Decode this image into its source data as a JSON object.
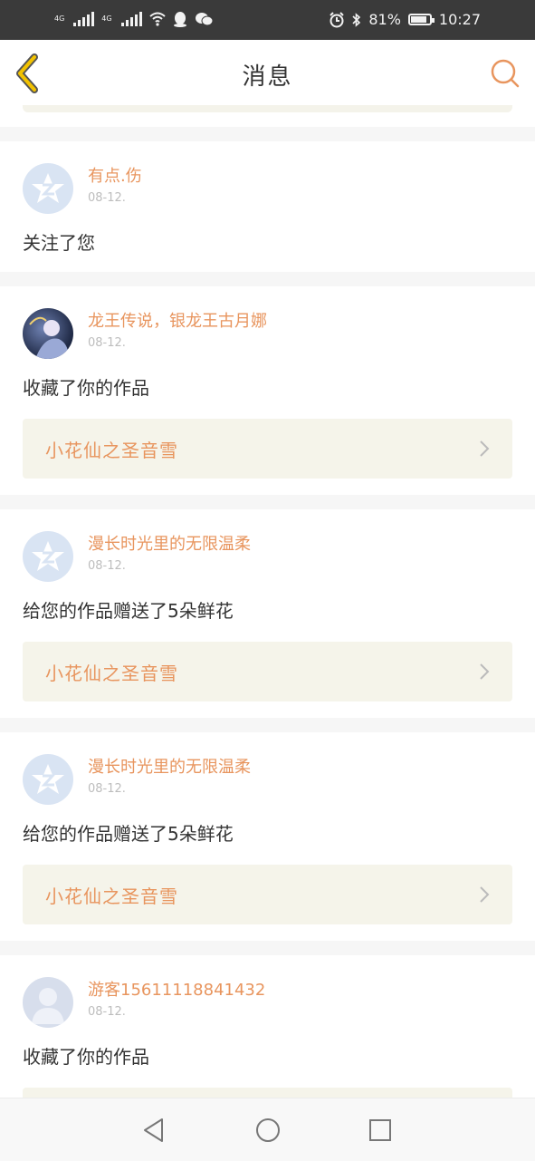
{
  "status_bar": {
    "network_1": "4G",
    "network_2": "4G",
    "battery": "81%",
    "time": "10:27",
    "icons": [
      "signal-icon",
      "signal-icon",
      "wifi-icon",
      "qq-icon",
      "wechat-icon",
      "alarm-icon",
      "bluetooth-icon",
      "battery-icon"
    ]
  },
  "header": {
    "title": "消息",
    "back_icon": "chevron-left-icon",
    "search_icon": "search-icon"
  },
  "messages": [
    {
      "name": "有点.伤",
      "time": "08-12.",
      "text": "关注了您",
      "avatar": "default-avatar"
    },
    {
      "name": "龙王传说，银龙王古月娜",
      "time": "08-12.",
      "text": "收藏了你的作品",
      "avatar": "photo-avatar",
      "work": "小花仙之圣音雪"
    },
    {
      "name": "漫长时光里的无限温柔",
      "time": "08-12.",
      "text": "给您的作品赠送了5朵鲜花",
      "avatar": "default-avatar",
      "work": "小花仙之圣音雪"
    },
    {
      "name": "漫长时光里的无限温柔",
      "time": "08-12.",
      "text": "给您的作品赠送了5朵鲜花",
      "avatar": "default-avatar",
      "work": "小花仙之圣音雪"
    },
    {
      "name": "游客15611118841432",
      "time": "08-12.",
      "text": "收藏了你的作品",
      "avatar": "guest-avatar"
    }
  ],
  "nav": [
    "back-triangle-icon",
    "home-circle-icon",
    "recents-square-icon"
  ],
  "colors": {
    "accent": "#e8955e",
    "work_bg": "#f5f4ea",
    "status_bg": "#3a3a3a"
  }
}
